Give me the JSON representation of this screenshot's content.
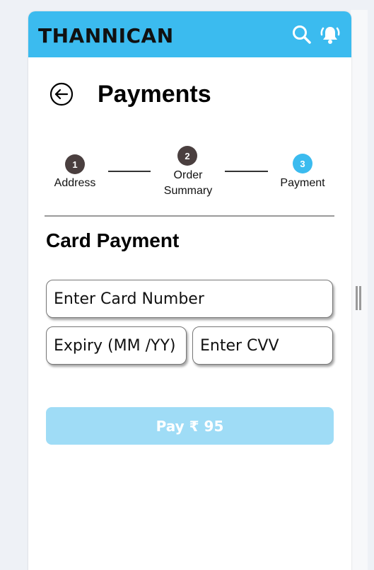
{
  "app": {
    "brand": "THANNICAN"
  },
  "header": {
    "title": "Payments"
  },
  "steps": [
    {
      "number": "1",
      "label": "Address",
      "state": "done"
    },
    {
      "number": "2",
      "label": "Order Summary",
      "state": "done"
    },
    {
      "number": "3",
      "label": "Payment",
      "state": "active"
    }
  ],
  "card_payment": {
    "title": "Card Payment",
    "card_number_placeholder": "Enter Card Number",
    "expiry_placeholder": "Expiry (MM /YY)",
    "cvv_placeholder": "Enter CVV"
  },
  "pay_button": {
    "label": "Pay ₹ 95"
  },
  "icons": {
    "search": "search-icon",
    "notifications": "bell-ringing-icon",
    "back": "back-arrow-icon"
  },
  "colors": {
    "accent": "#3bbbef",
    "pay_button_disabled": "#9fdcf6",
    "step_dark": "#4a3f3f"
  }
}
